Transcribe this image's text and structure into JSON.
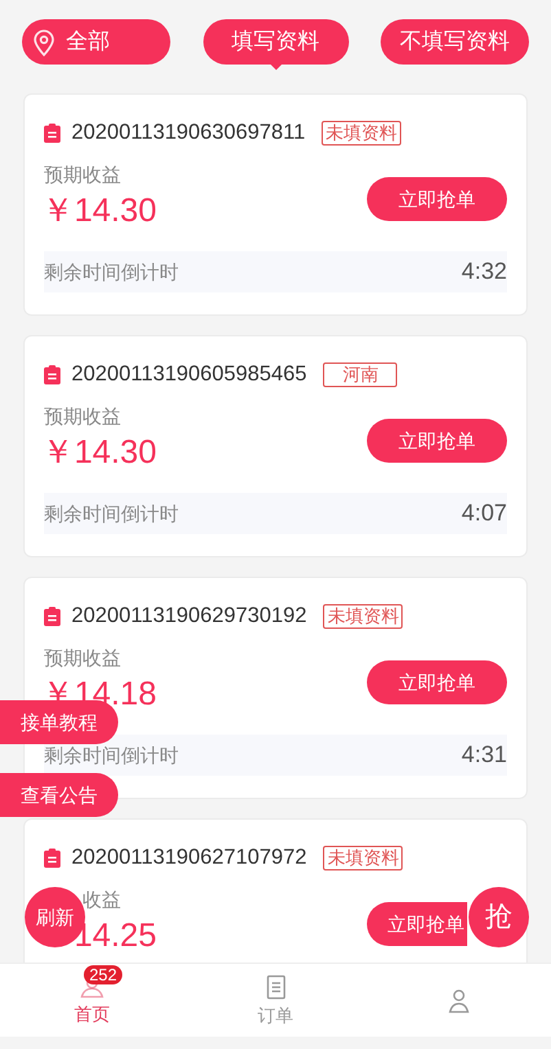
{
  "filters": [
    {
      "label": "全部",
      "selected": false
    },
    {
      "label": "填写资料",
      "selected": true
    },
    {
      "label": "不填写资料",
      "selected": false
    }
  ],
  "orders": [
    {
      "id": "20200113190630697811",
      "tag": "未填资料",
      "income_label": "预期收益",
      "amount": "￥14.30",
      "button": "立即抢单",
      "countdown_label": "剩余时间倒计时",
      "countdown": "4:32"
    },
    {
      "id": "20200113190605985465",
      "tag": "河南",
      "income_label": "预期收益",
      "amount": "￥14.30",
      "button": "立即抢单",
      "countdown_label": "剩余时间倒计时",
      "countdown": "4:07"
    },
    {
      "id": "20200113190629730192",
      "tag": "未填资料",
      "income_label": "预期收益",
      "amount": "￥14.18",
      "button": "立即抢单",
      "countdown_label": "剩余时间倒计时",
      "countdown": "4:31"
    },
    {
      "id": "20200113190627107972",
      "tag": "未填资料",
      "income_label": "收益",
      "amount": "14.25",
      "button": "立即抢单"
    }
  ],
  "side_buttons": [
    "接单教程",
    "查看公告"
  ],
  "refresh_button": "刷新",
  "grab_button": "抢",
  "nav": [
    {
      "label": "首页",
      "badge": "252",
      "selected": true
    },
    {
      "label": "订单",
      "selected": false
    },
    {
      "selected": false
    }
  ]
}
